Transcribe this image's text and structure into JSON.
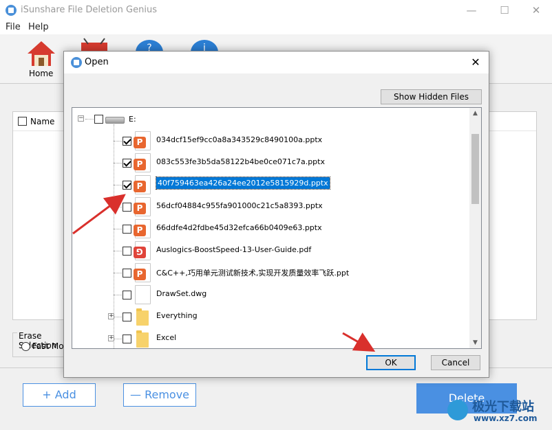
{
  "app": {
    "title": "iSunshare File Deletion Genius",
    "window_controls": [
      "—",
      "☐",
      "✕"
    ],
    "menu": [
      "File",
      "Help"
    ],
    "toolbar": {
      "home_label": "Home"
    },
    "list": {
      "header_name": "Name"
    },
    "erase": {
      "title": "Erase Selection",
      "fast_mode": "Fast Mode"
    },
    "buttons": {
      "add": "+ Add",
      "remove": "— Remove",
      "delete": "Delete"
    },
    "watermark": {
      "text": "极光下载站",
      "url": "www.xz7.com"
    }
  },
  "dialog": {
    "title": "Open",
    "close": "✕",
    "show_hidden": "Show Hidden Files",
    "ok": "OK",
    "cancel": "Cancel",
    "drive": "E:",
    "files": [
      {
        "name": "034dcf15ef9cc0a8a343529c8490100a.pptx",
        "checked": true,
        "type": "pptx"
      },
      {
        "name": "083c553fe3b5da58122b4be0ce071c7a.pptx",
        "checked": true,
        "type": "pptx"
      },
      {
        "name": "40f759463ea426a24ee2012e5815929d.pptx",
        "checked": true,
        "type": "pptx",
        "selected": true
      },
      {
        "name": "56dcf04884c955fa901000c21c5a8393.pptx",
        "checked": false,
        "type": "pptx"
      },
      {
        "name": "66ddfe4d2fdbe45d32efca66b0409e63.pptx",
        "checked": false,
        "type": "pptx"
      },
      {
        "name": "Auslogics-BoostSpeed-13-User-Guide.pdf",
        "checked": false,
        "type": "pdf"
      },
      {
        "name": "C&C++,巧用单元测试新技术,实现开发质量效率飞跃.ppt",
        "checked": false,
        "type": "ppt"
      },
      {
        "name": "DrawSet.dwg",
        "checked": false,
        "type": "dwg"
      },
      {
        "name": "Everything",
        "checked": false,
        "type": "folder"
      },
      {
        "name": "Excel",
        "checked": false,
        "type": "folder"
      }
    ]
  },
  "colors": {
    "accent": "#4a90e2",
    "pptx": "#e8662f",
    "pdf": "#e0443a",
    "selection": "#0078d7",
    "arrow": "#d9302c"
  }
}
